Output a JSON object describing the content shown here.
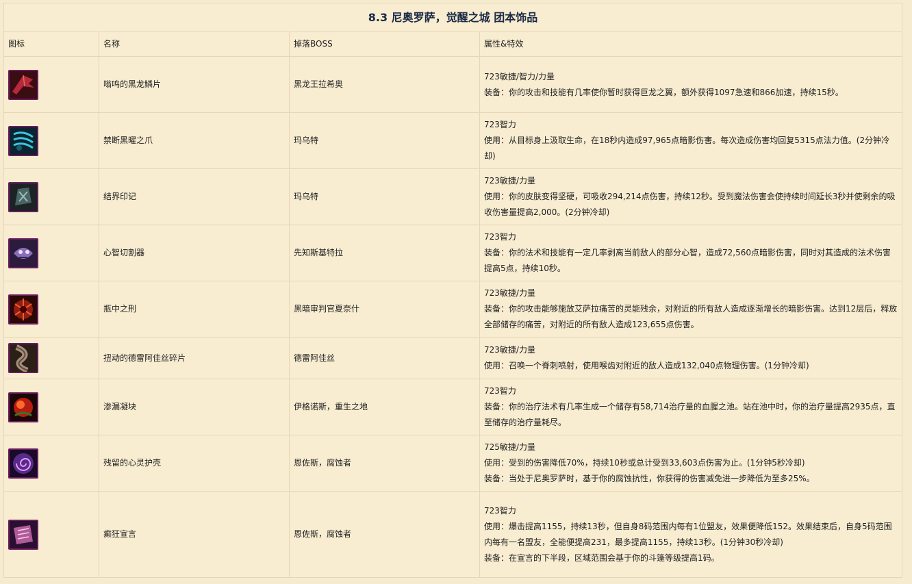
{
  "title": "8.3 尼奥罗萨，觉醒之城 团本饰品",
  "columns": [
    "图标",
    "名称",
    "掉落BOSS",
    "属性&特效"
  ],
  "rows": [
    {
      "icon": "dragon-wing-icon",
      "name": "嗡鸣的黑龙鳞片",
      "boss": "黑龙王拉希奥",
      "attrs": [
        "723敏捷/智力/力量",
        "装备：你的攻击和技能有几率使你暂时获得巨龙之翼，额外获得1097急速和866加速，持续15秒。"
      ]
    },
    {
      "icon": "claw-icon",
      "name": "禁断黑曜之爪",
      "boss": "玛乌特",
      "attrs": [
        "723智力",
        "使用：从目标身上汲取生命，在18秒内造成97,965点暗影伤害。每次造成伤害均回复5315点法力值。(2分钟冷却)"
      ]
    },
    {
      "icon": "ward-rune-icon",
      "name": "结界印记",
      "boss": "玛乌特",
      "attrs": [
        "723敏捷/力量",
        "使用：你的皮肤变得坚硬，可吸收294,214点伤害，持续12秒。受到魔法伤害会使持续时间延长3秒并使剩余的吸收伤害量提高2,000。(2分钟冷却)"
      ]
    },
    {
      "icon": "mind-slicer-icon",
      "name": "心智切割器",
      "boss": "先知斯基特拉",
      "attrs": [
        "723智力",
        "装备：你的法术和技能有一定几率剥离当前敌人的部分心智，造成72,560点暗影伤害，同时对其造成的法术伤害提高5点，持续10秒。"
      ]
    },
    {
      "icon": "bottled-torment-icon",
      "name": "瓶中之刑",
      "boss": "黑暗审判官夏奈什",
      "attrs": [
        "723敏捷/力量",
        "装备：你的攻击能够施放艾萨拉痛苦的灵能残余，对附近的所有敌人造成逐渐增长的暗影伤害。达到12层后，释放全部储存的痛苦，对附近的所有敌人造成123,655点伤害。"
      ]
    },
    {
      "icon": "twisted-shard-icon",
      "name": "扭动的德雷阿佳丝碎片",
      "boss": "德雷阿佳丝",
      "attrs": [
        "723敏捷/力量",
        "使用：召唤一个脊刺喷射，使用喉齿对附近的敌人造成132,040点物理伤害。(1分钟冷却)"
      ]
    },
    {
      "icon": "seeping-clot-icon",
      "name": "渗漏凝块",
      "boss": "伊格诺斯，重生之地",
      "attrs": [
        "723智力",
        "装备：你的治疗法术有几率生成一个储存有58,714治疗量的血腥之池。站在池中时，你的治疗量提高2935点，直至储存的治疗量耗尽。"
      ]
    },
    {
      "icon": "psyche-shell-icon",
      "name": "残留的心灵护壳",
      "boss": "恩佐斯，腐蚀者",
      "attrs": [
        "725敏捷/力量",
        "使用：受到的伤害降低70%，持续10秒或总计受到33,603点伤害为止。(1分钟5秒冷却)",
        "装备：当处于尼奥罗萨时，基于你的腐蚀抗性，你获得的伤害减免进一步降低为至多25%。"
      ]
    },
    {
      "icon": "manifesto-icon",
      "name": "癫狂宣言",
      "boss": "恩佐斯，腐蚀者",
      "attrs": [
        "723智力",
        "使用：爆击提高1155，持续13秒，但自身8码范围内每有1位盟友，效果便降低152。效果结束后，自身5码范围内每有一名盟友，全能便提高231，最多提高1155，持续13秒。(1分钟30秒冷却)",
        "装备：在宣言的下半段，区域范围会基于你的斗篷等级提高1码。"
      ]
    }
  ]
}
